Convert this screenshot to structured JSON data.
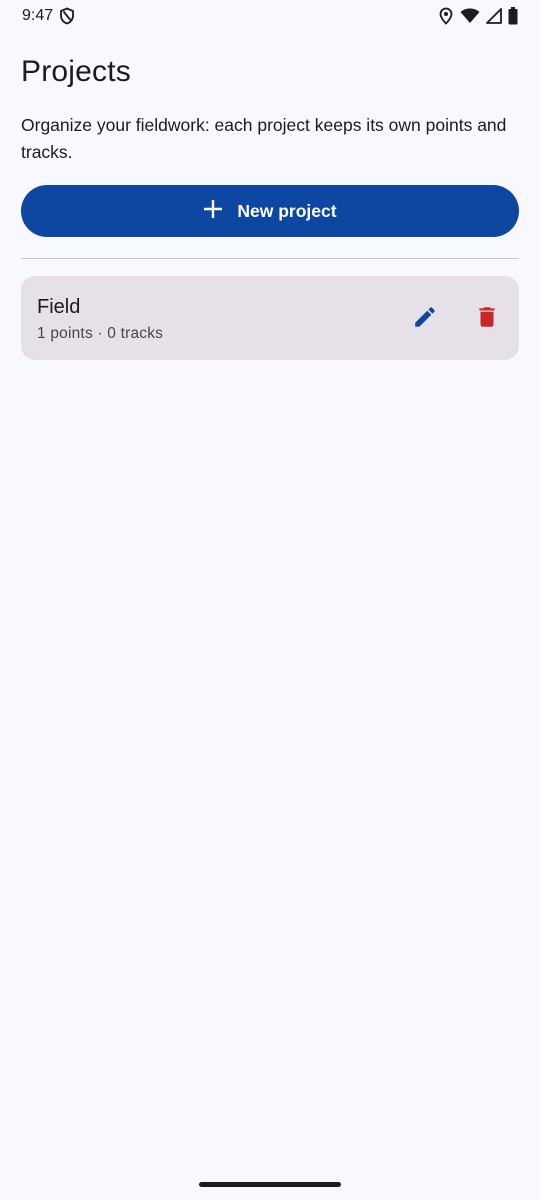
{
  "status_bar": {
    "time": "9:47",
    "icons": [
      "shield-icon",
      "location-icon",
      "wifi-icon",
      "signal-icon",
      "battery-icon"
    ]
  },
  "header": {
    "title": "Projects",
    "subtitle": "Organize your fieldwork: each project keeps its own points and tracks."
  },
  "actions": {
    "new_project_label": "New project",
    "new_project_icon": "plus-icon"
  },
  "projects": [
    {
      "name": "Field",
      "meta": "1 points · 0 tracks",
      "edit_icon": "pencil-icon",
      "delete_icon": "trash-icon"
    }
  ],
  "colors": {
    "background": "#f8f9ff",
    "primary": "#0d47a1",
    "card": "#e6e1e8",
    "delete": "#c62828"
  }
}
